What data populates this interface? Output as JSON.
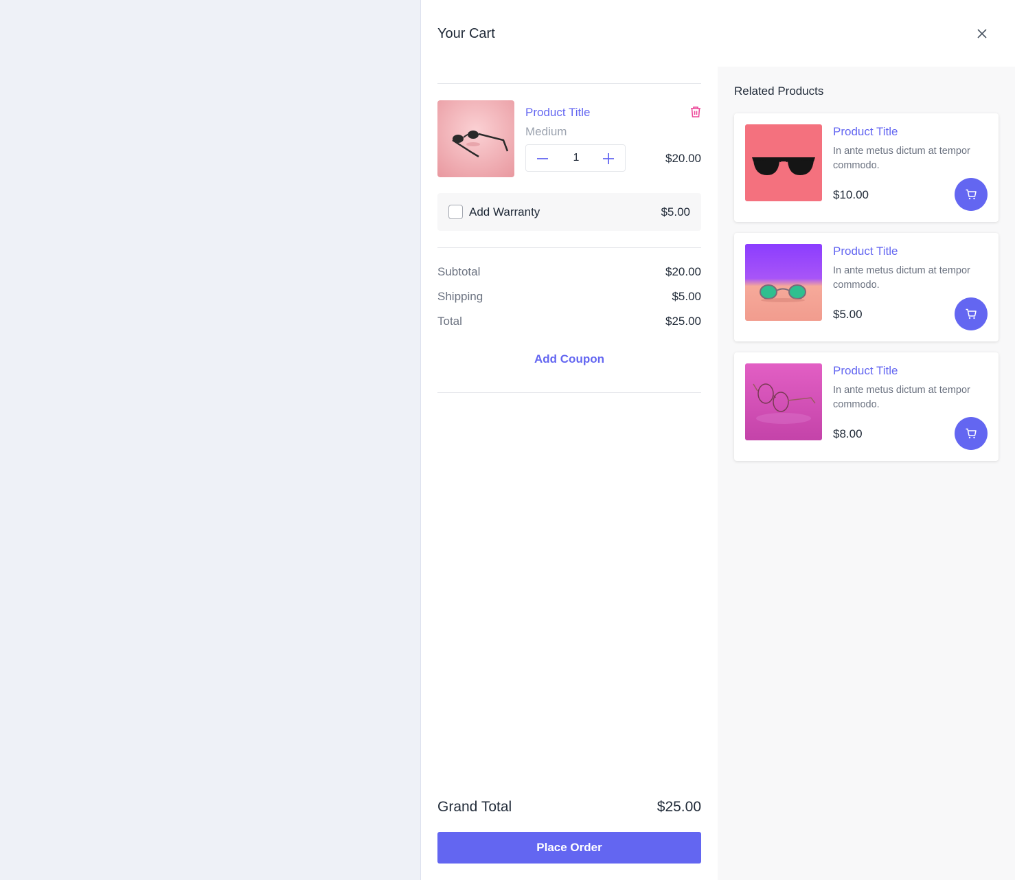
{
  "cart": {
    "title": "Your Cart",
    "item": {
      "title": "Product Title",
      "variant": "Medium",
      "quantity": "1",
      "price": "$20.00",
      "image_icon": "sunglasses-photo"
    },
    "warranty": {
      "label": "Add Warranty",
      "price": "$5.00",
      "checked": false
    },
    "summary": {
      "subtotal_label": "Subtotal",
      "subtotal": "$20.00",
      "shipping_label": "Shipping",
      "shipping": "$5.00",
      "total_label": "Total",
      "total": "$25.00"
    },
    "coupon_label": "Add Coupon",
    "grand_total_label": "Grand Total",
    "grand_total": "$25.00",
    "place_order_label": "Place Order"
  },
  "related": {
    "title": "Related Products",
    "products": [
      {
        "title": "Product Title",
        "description": "In ante metus dictum at tempor commodo.",
        "price": "$10.00"
      },
      {
        "title": "Product Title",
        "description": "In ante metus dictum at tempor commodo.",
        "price": "$5.00"
      },
      {
        "title": "Product Title",
        "description": "In ante metus dictum at tempor commodo.",
        "price": "$8.00"
      }
    ]
  },
  "colors": {
    "accent": "#6366f1",
    "trash": "#ec4899",
    "backdrop": "#eef1f7",
    "related_bg": "#f8f8f9"
  }
}
